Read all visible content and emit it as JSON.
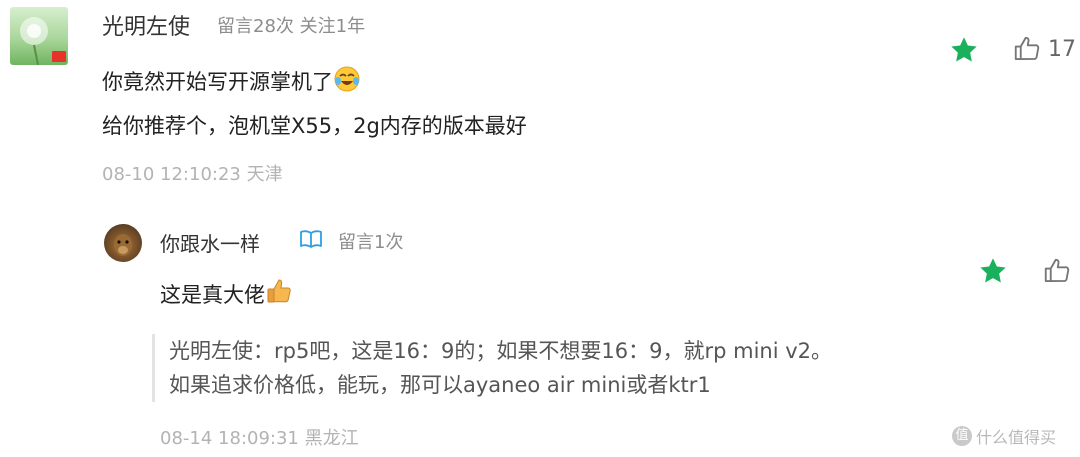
{
  "comment": {
    "author": "光明左使",
    "meta": "留言28次 关注1年",
    "lines": [
      "你竟然开始写开源掌机了",
      "给你推荐个，泡机堂X55，2g内存的版本最好"
    ],
    "timestamp": "08-10 12:10:23 天津",
    "like_count": "17"
  },
  "reply": {
    "author": "你跟水一样",
    "meta": "留言1次",
    "text": "这是真大佬",
    "quote_lines": [
      "光明左使：rp5吧，这是16：9的；如果不想要16：9，就rp mini v2。",
      "如果追求价格低，能玩，那可以ayaneo air mini或者ktr1"
    ],
    "timestamp": "08-14 18:09:31 黑龙江"
  },
  "watermark": {
    "text": "什么值得买",
    "badge": "值"
  },
  "colors": {
    "star": "#1bb05b",
    "text": "#222222",
    "meta": "#8d8d8d",
    "timestamp": "#b3b3b3",
    "badge": "#2f9fe0"
  }
}
